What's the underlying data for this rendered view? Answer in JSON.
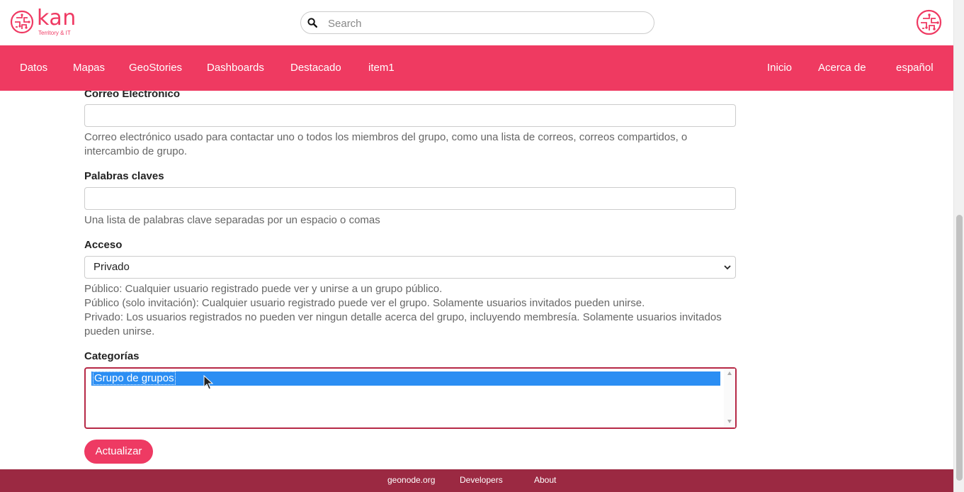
{
  "brand": {
    "name": "kan",
    "tagline": "Territory & IT",
    "color": "#ef3a63"
  },
  "search": {
    "placeholder": "Search",
    "icon": "search-icon"
  },
  "nav": {
    "left": [
      "Datos",
      "Mapas",
      "GeoStories",
      "Dashboards",
      "Destacado",
      "item1"
    ],
    "right": [
      "Inicio",
      "Acerca de",
      "español"
    ],
    "color": "#ef3a61"
  },
  "form": {
    "email": {
      "label": "Correo Electrónico",
      "value": "",
      "help": "Correo electrónico usado para contactar uno o todos los miembros del grupo, como una lista de correos, correos compartidos, o intercambio de grupo."
    },
    "keywords": {
      "label": "Palabras claves",
      "value": "",
      "help": "Una lista de palabras clave separadas por un espacio o comas"
    },
    "access": {
      "label": "Acceso",
      "selected": "Privado",
      "help": [
        "Público: Cualquier usuario registrado puede ver y unirse a un grupo público.",
        "Público (solo invitación): Cualquier usuario registrado puede ver el grupo. Solamente usuarios invitados pueden unirse.",
        "Privado: Los usuarios registrados no pueden ver ningun detalle acerca del grupo, incluyendo membresía. Solamente usuarios invitados pueden unirse."
      ]
    },
    "categories": {
      "label": "Categorías",
      "options": [
        "Grupo de grupos"
      ],
      "selected_color": "#2b8ef3"
    },
    "submit_label": "Actualizar"
  },
  "footer": {
    "links": [
      "geonode.org",
      "Developers",
      "About"
    ],
    "color": "#9b2942"
  }
}
